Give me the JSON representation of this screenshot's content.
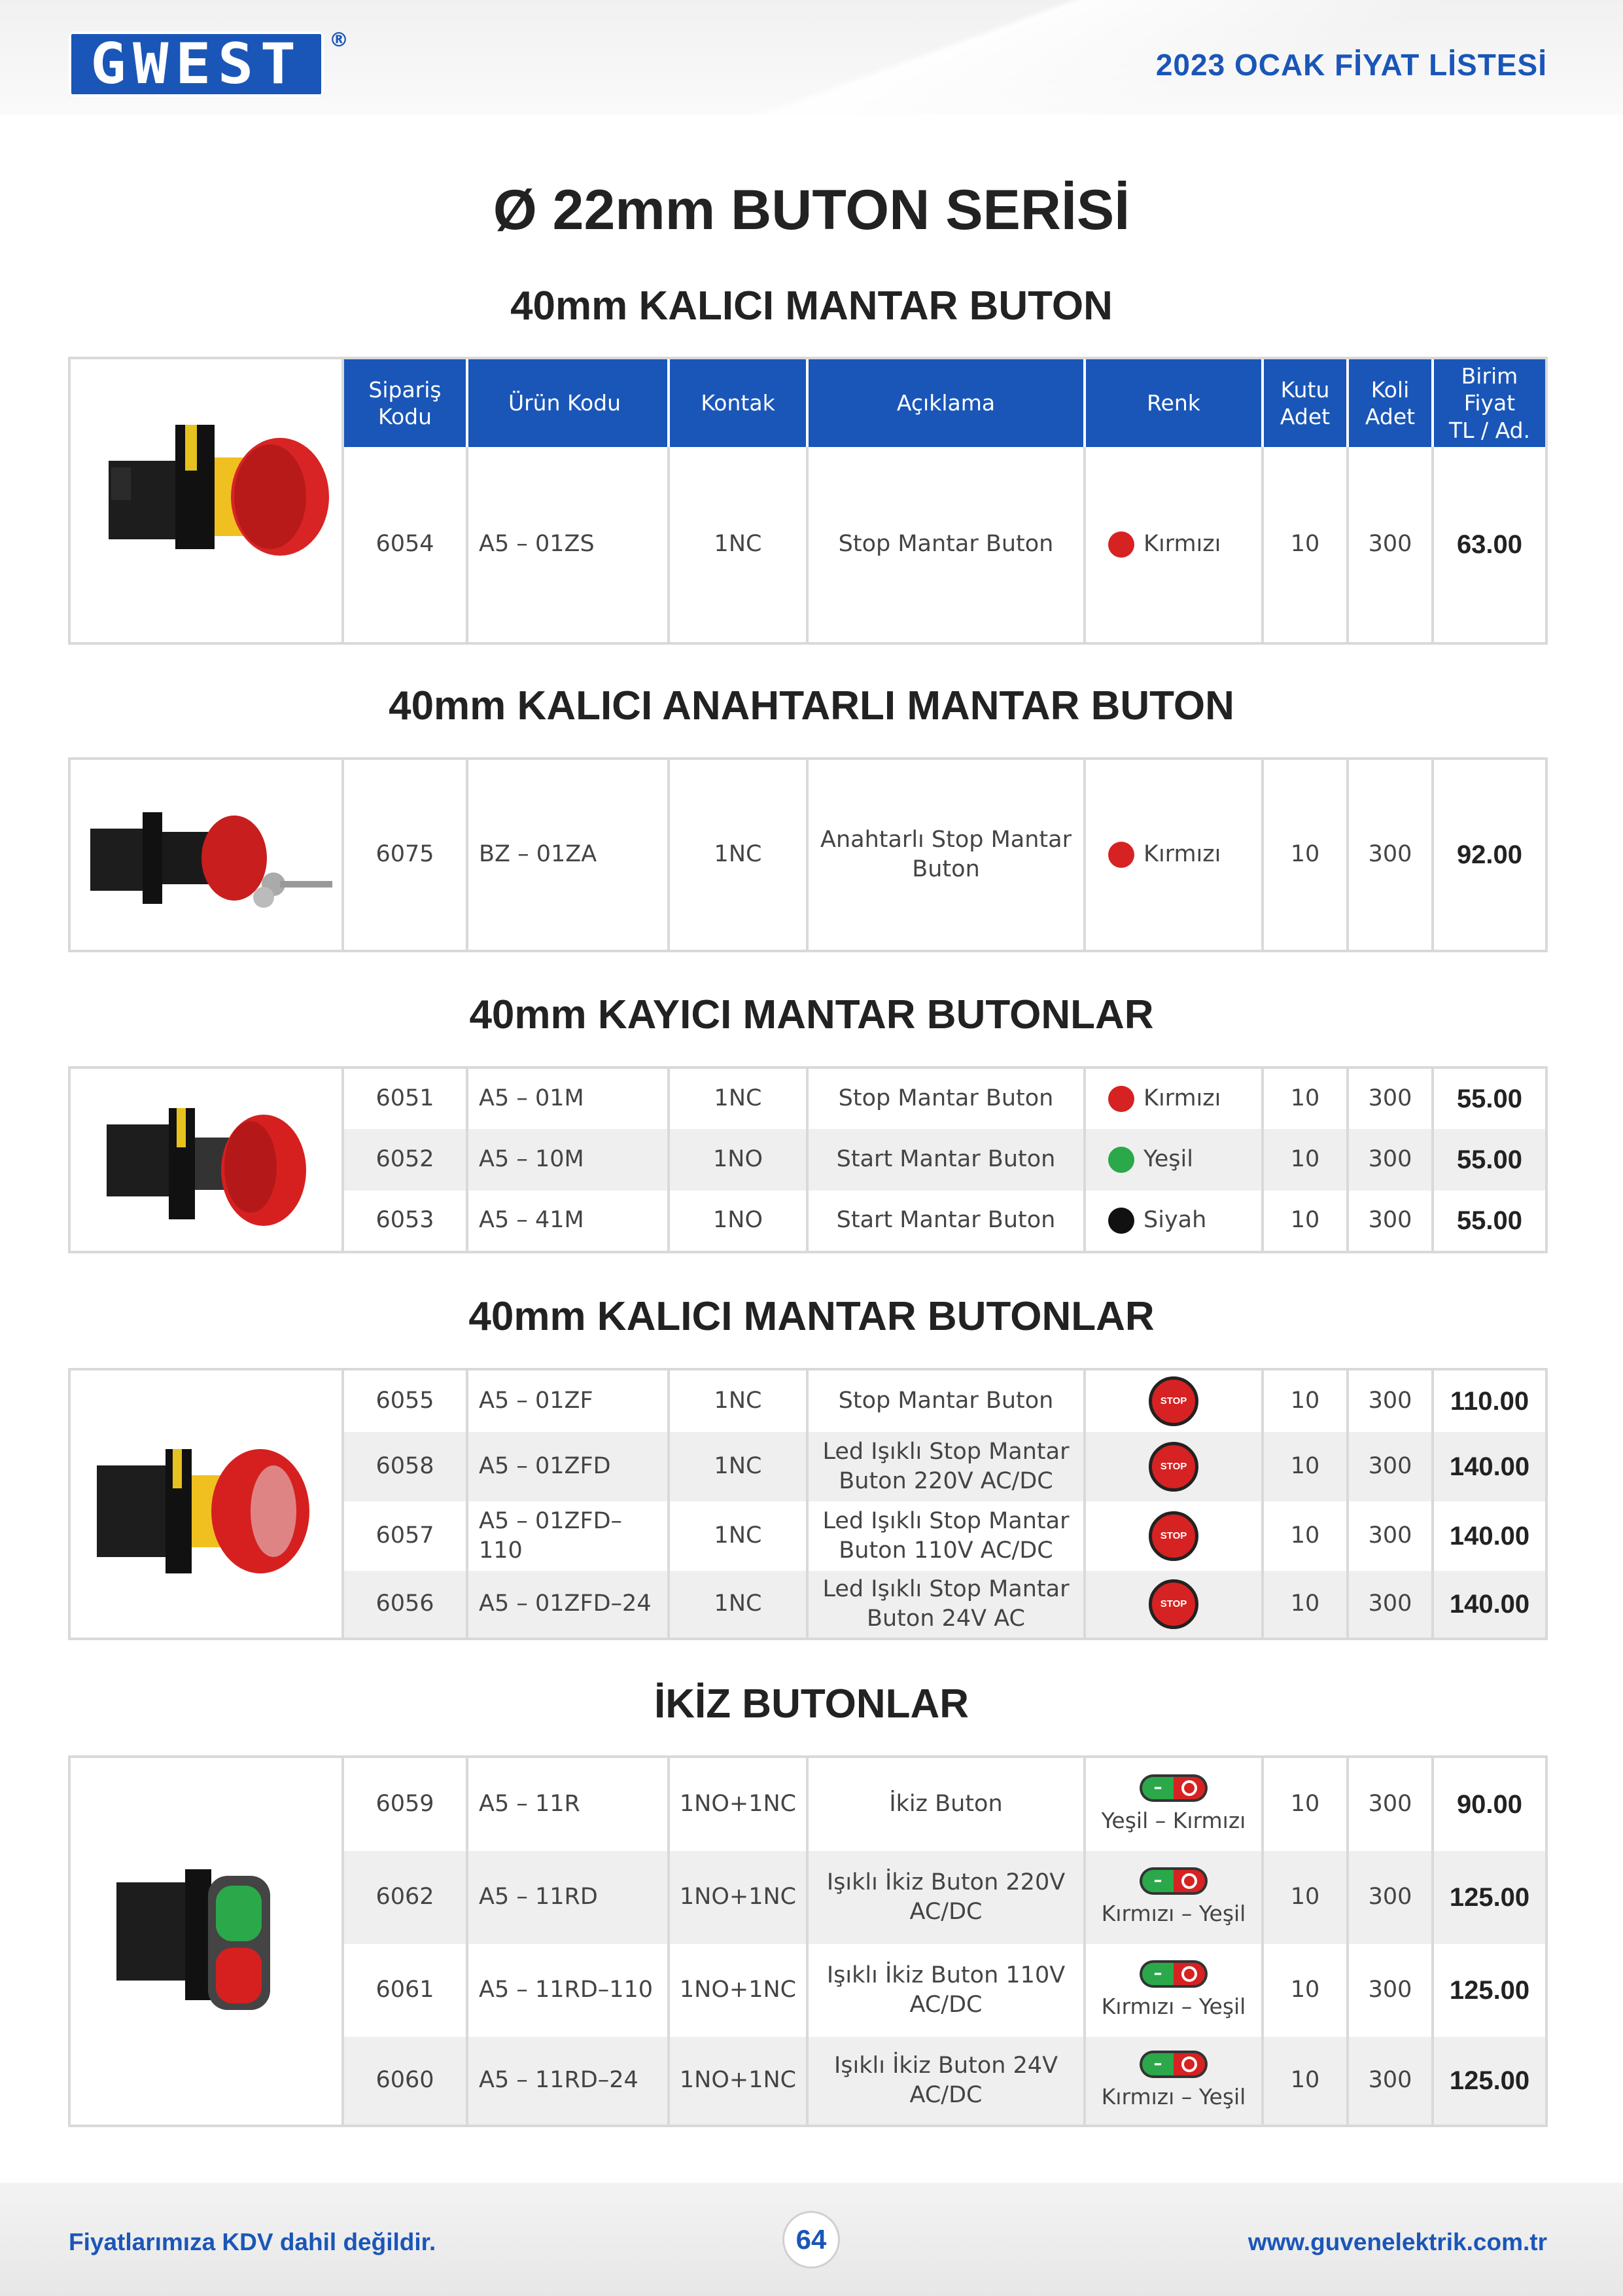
{
  "header": {
    "logo_text": "GWEST",
    "registered": "®",
    "title": "2023 OCAK FİYAT LİSTESİ"
  },
  "page_title": "Ø 22mm BUTON SERİSİ",
  "table_headers": [
    "Sipariş Kodu",
    "Ürün Kodu",
    "Kontak",
    "Açıklama",
    "Renk",
    "Kutu Adet",
    "Koli Adet",
    "Birim Fiyat TL / Ad."
  ],
  "table_headers_display": [
    "Sipariş\nKodu",
    "Ürün Kodu",
    "Kontak",
    "Açıklama",
    "Renk",
    "Kutu\nAdet",
    "Koli\nAdet",
    "Birim\nFiyat\nTL / Ad."
  ],
  "sections": [
    {
      "title": "40mm KALICI MANTAR BUTON",
      "rows": [
        {
          "siparis": "6054",
          "urun": "A5 – 01ZS",
          "kontak": "1NC",
          "aciklama": "Stop Mantar Buton",
          "renk": "Kırmızı",
          "renk_color": "#d62222",
          "kutu": "10",
          "koli": "300",
          "fiyat": "63.00"
        }
      ]
    },
    {
      "title": "40mm KALICI ANAHTARLI MANTAR BUTON",
      "rows": [
        {
          "siparis": "6075",
          "urun": "BZ – 01ZA",
          "kontak": "1NC",
          "aciklama": "Anahtarlı Stop Mantar Buton",
          "renk": "Kırmızı",
          "renk_color": "#d62222",
          "kutu": "10",
          "koli": "300",
          "fiyat": "92.00"
        }
      ]
    },
    {
      "title": "40mm KAYICI MANTAR BUTONLAR",
      "rows": [
        {
          "siparis": "6051",
          "urun": "A5 – 01M",
          "kontak": "1NC",
          "aciklama": "Stop Mantar Buton",
          "renk": "Kırmızı",
          "renk_color": "#d62222",
          "kutu": "10",
          "koli": "300",
          "fiyat": "55.00"
        },
        {
          "siparis": "6052",
          "urun": "A5 – 10M",
          "kontak": "1NO",
          "aciklama": "Start Mantar Buton",
          "renk": "Yeşil",
          "renk_color": "#2aa84a",
          "kutu": "10",
          "koli": "300",
          "fiyat": "55.00"
        },
        {
          "siparis": "6053",
          "urun": "A5 – 41M",
          "kontak": "1NO",
          "aciklama": "Start Mantar Buton",
          "renk": "Siyah",
          "renk_color": "#111111",
          "kutu": "10",
          "koli": "300",
          "fiyat": "55.00"
        }
      ]
    },
    {
      "title": "40mm KALICI MANTAR BUTONLAR",
      "stop_icon_label": "STOP",
      "rows": [
        {
          "siparis": "6055",
          "urun": "A5 – 01ZF",
          "kontak": "1NC",
          "aciklama": "Stop Mantar Buton",
          "kutu": "10",
          "koli": "300",
          "fiyat": "110.00"
        },
        {
          "siparis": "6058",
          "urun": "A5 – 01ZFD",
          "kontak": "1NC",
          "aciklama": "Led Işıklı Stop Mantar Buton 220V AC/DC",
          "kutu": "10",
          "koli": "300",
          "fiyat": "140.00"
        },
        {
          "siparis": "6057",
          "urun": "A5 – 01ZFD–110",
          "kontak": "1NC",
          "aciklama": "Led Işıklı Stop Mantar Buton 110V AC/DC",
          "kutu": "10",
          "koli": "300",
          "fiyat": "140.00"
        },
        {
          "siparis": "6056",
          "urun": "A5 – 01ZFD–24",
          "kontak": "1NC",
          "aciklama": "Led Işıklı Stop Mantar Buton 24V AC",
          "kutu": "10",
          "koli": "300",
          "fiyat": "140.00"
        }
      ]
    },
    {
      "title": "İKİZ BUTONLAR",
      "rows": [
        {
          "siparis": "6059",
          "urun": "A5 – 11R",
          "kontak": "1NO+1NC",
          "aciklama": "İkiz Buton",
          "renk": "Yeşil – Kırmızı",
          "kutu": "10",
          "koli": "300",
          "fiyat": "90.00"
        },
        {
          "siparis": "6062",
          "urun": "A5 – 11RD",
          "kontak": "1NO+1NC",
          "aciklama": "Işıklı İkiz Buton 220V AC/DC",
          "renk": "Kırmızı – Yeşil",
          "kutu": "10",
          "koli": "300",
          "fiyat": "125.00"
        },
        {
          "siparis": "6061",
          "urun": "A5 – 11RD–110",
          "kontak": "1NO+1NC",
          "aciklama": "Işıklı İkiz Buton 110V AC/DC",
          "renk": "Kırmızı – Yeşil",
          "kutu": "10",
          "koli": "300",
          "fiyat": "125.00"
        },
        {
          "siparis": "6060",
          "urun": "A5 – 11RD–24",
          "kontak": "1NO+1NC",
          "aciklama": "Işıklı İkiz Buton 24V AC/DC",
          "renk": "Kırmızı – Yeşil",
          "kutu": "10",
          "koli": "300",
          "fiyat": "125.00"
        }
      ]
    }
  ],
  "footer": {
    "note": "Fiyatlarımıza KDV dahil değildir.",
    "page_number": "64",
    "website": "www.guvenelektrik.com.tr"
  },
  "colors": {
    "brand_blue": "#1a56b8",
    "stop_red": "#d62222",
    "start_green": "#2aa84a",
    "border_gray": "#d9d9d9",
    "alt_row": "#efefef"
  }
}
